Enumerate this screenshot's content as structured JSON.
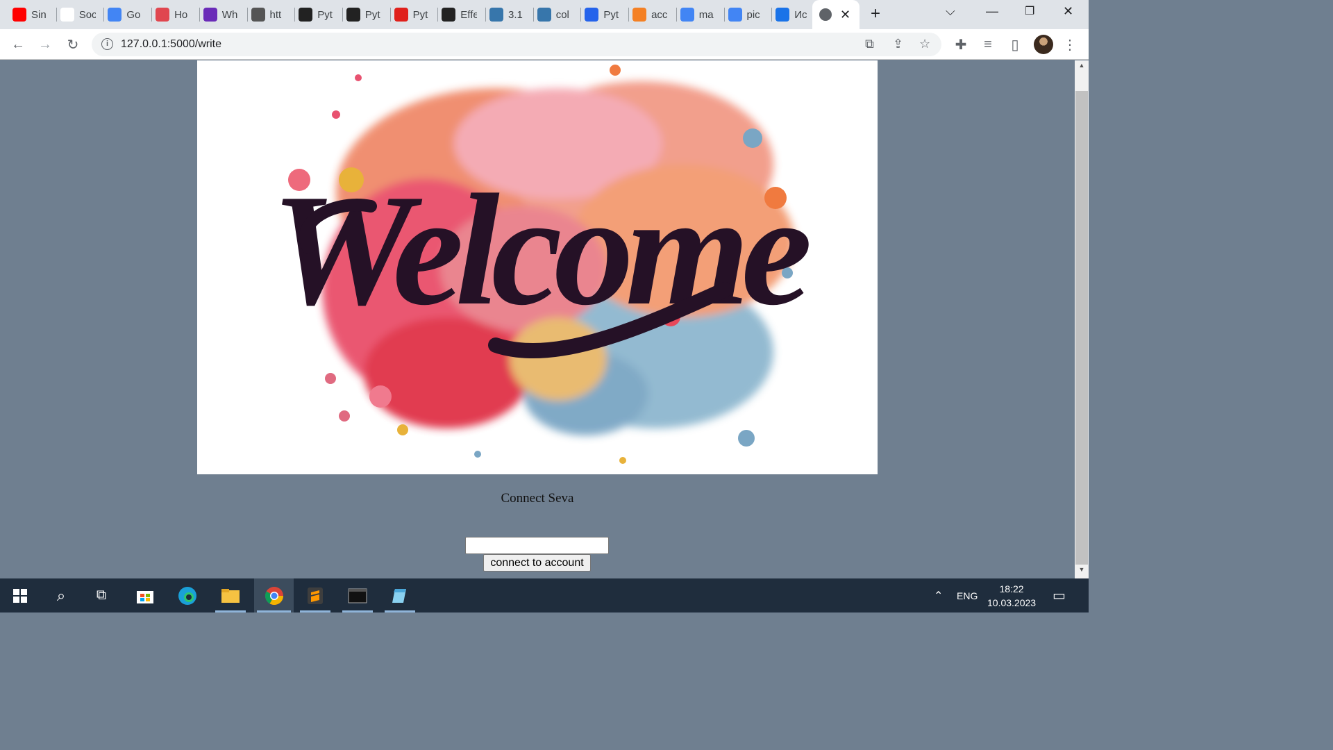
{
  "browser": {
    "tabs": [
      {
        "title": "Sin",
        "icon": "youtube-icon",
        "color": "#ff0000"
      },
      {
        "title": "Soc",
        "icon": "pn-icon",
        "color": "#ffffff"
      },
      {
        "title": "Go",
        "icon": "google-translate-icon",
        "color": "#4285f4"
      },
      {
        "title": "Ho",
        "icon": "pinterest-like-icon",
        "color": "#e0464f"
      },
      {
        "title": "Wh",
        "icon": "wh-icon",
        "color": "#6a2bb8"
      },
      {
        "title": "htt",
        "icon": "page-icon",
        "color": "#555555"
      },
      {
        "title": "Pyt",
        "icon": "rw-icon",
        "color": "#222222"
      },
      {
        "title": "Pyt",
        "icon": "globe-dark-icon",
        "color": "#222222"
      },
      {
        "title": "Pyt",
        "icon": "v-icon",
        "color": "#e0201b"
      },
      {
        "title": "Effe",
        "icon": "globe-dark-icon",
        "color": "#222222"
      },
      {
        "title": "3.1",
        "icon": "python-icon",
        "color": "#3776ab"
      },
      {
        "title": "col",
        "icon": "python-icon",
        "color": "#3776ab"
      },
      {
        "title": "Pyt",
        "icon": "p-icon",
        "color": "#2563eb"
      },
      {
        "title": "acc",
        "icon": "stackoverflow-icon",
        "color": "#f48024"
      },
      {
        "title": "ma",
        "icon": "google-icon",
        "color": "#4285f4"
      },
      {
        "title": "pic",
        "icon": "google-icon",
        "color": "#4285f4"
      },
      {
        "title": "Ис",
        "icon": "history-icon",
        "color": "#1a73e8"
      }
    ],
    "active_tab_icon": "globe-icon",
    "url": "127.0.0.1:5000/write"
  },
  "page": {
    "hero_text": "Welcome",
    "caption": "Connect Seva",
    "input_value": "",
    "button_label": "connect to account"
  },
  "taskbar": {
    "language": "ENG",
    "time": "18:22",
    "date": "10.03.2023"
  }
}
